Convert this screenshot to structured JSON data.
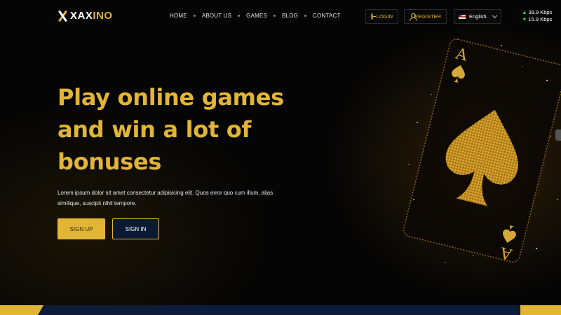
{
  "brand": {
    "logo_text_white": "XAX",
    "logo_text_gold": "INO"
  },
  "nav": {
    "items": [
      {
        "label": "HOME"
      },
      {
        "label": "ABOUT US"
      },
      {
        "label": "GAMES"
      },
      {
        "label": "BLOG"
      },
      {
        "label": "CONTACT"
      }
    ]
  },
  "auth": {
    "login_label": "LOGIN",
    "register_label": "REGISTER"
  },
  "language": {
    "selected": "English",
    "flag_icon": "us-flag-icon"
  },
  "network_speed": {
    "upload": "39.9 Kbps",
    "download": "15.9 Kbps"
  },
  "hero": {
    "headline": "Play online games and win a lot of bonuses",
    "lead": "Lorem ipsum dolor sit amet consectetur adipisicing elit. Quos error quo cum illum, alias similique, suscipit nihil tempore.",
    "signup_label": "SIGN UP",
    "signin_label": "SIGN IN"
  },
  "art": {
    "card_rank": "A",
    "card_suit": "spade-icon"
  },
  "colors": {
    "gold": "#e3b534",
    "navy": "#0c1c3a",
    "background": "#050505"
  }
}
